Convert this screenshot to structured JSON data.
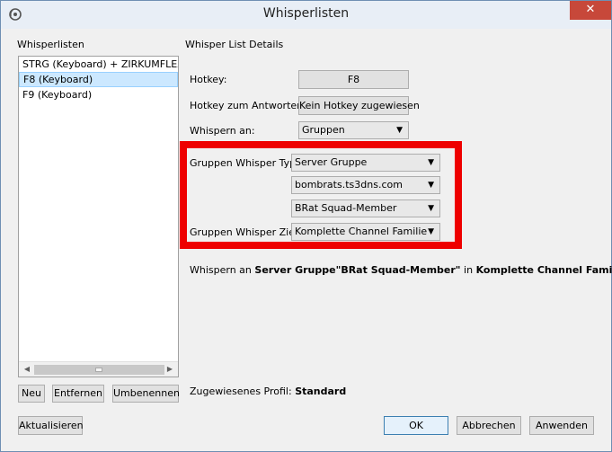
{
  "window": {
    "title": "Whisperlisten",
    "close_glyph": "✕"
  },
  "left": {
    "section_label": "Whisperlisten",
    "items": [
      "STRG (Keyboard) + ZIRKUMFLEX",
      "F8 (Keyboard)",
      "F9 (Keyboard)"
    ],
    "selected_index": 1,
    "buttons": {
      "new": "Neu",
      "remove": "Entfernen",
      "rename": "Umbenennen"
    }
  },
  "details": {
    "section_label": "Whisper List Details",
    "hotkey_label": "Hotkey:",
    "hotkey_value": "F8",
    "reply_label": "Hotkey zum Antworten:",
    "reply_value": "Kein Hotkey zugewiesen",
    "whisper_to_label": "Whispern an:",
    "whisper_to_value": "Gruppen",
    "group_type_label": "Gruppen Whisper Typ:",
    "group_type_value": "Server Gruppe",
    "server_value": "bombrats.ts3dns.com",
    "group_value": "BRat Squad-Member",
    "group_target_label": "Gruppen Whisper Ziel:",
    "group_target_value": "Komplette Channel Familie"
  },
  "summary": {
    "prefix": "Whispern an ",
    "type": "Server Gruppe",
    "group": "\"BRat Squad-Member\"",
    "mid": " in ",
    "target": "Komplette Channel Familie"
  },
  "profile": {
    "label": "Zugewiesenes Profil:",
    "value": "Standard"
  },
  "footer": {
    "refresh": "Aktualisieren",
    "ok": "OK",
    "cancel": "Abbrechen",
    "apply": "Anwenden"
  },
  "colors": {
    "highlight": "#ee0000",
    "selection": "#cce8ff",
    "close": "#c7483a"
  }
}
